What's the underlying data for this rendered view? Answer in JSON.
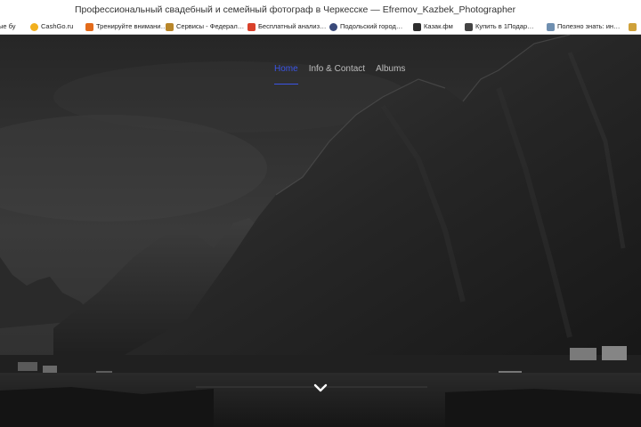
{
  "window": {
    "title": "Профессиональный свадебный и семейный фотограф в Черкесске — Efremov_Kazbek_Photographer"
  },
  "bookmarks": [
    {
      "label": "ые бу",
      "icon": "bookmark-page-icon",
      "color": "#9aa4b1"
    },
    {
      "label": "CashGo.ru",
      "icon": "cashgo-icon",
      "color": "#f2b01e"
    },
    {
      "label": "Тренируйте внимани…",
      "icon": "bookmark-page-icon",
      "color": "#e36b1b"
    },
    {
      "label": "Сервисы - Федерал…",
      "icon": "bookmark-page-icon",
      "color": "#b8862a"
    },
    {
      "label": "Бесплатный анализ…",
      "icon": "calendar-icon",
      "color": "#d9412b"
    },
    {
      "label": "Подольский город…",
      "icon": "bookmark-page-icon",
      "color": "#3a4a7a"
    },
    {
      "label": "Казак.фм",
      "icon": "bookmark-page-icon",
      "color": "#2d2d2d"
    },
    {
      "label": "Купить в 1Подар…",
      "icon": "bookmark-page-icon",
      "color": "#444444"
    },
    {
      "label": "Полезно знать: ин…",
      "icon": "bookmark-page-icon",
      "color": "#6f8fb0"
    },
    {
      "label": "",
      "icon": "bookmark-page-icon",
      "color": "#cfa13a"
    }
  ],
  "nav": {
    "home": "Home",
    "info": "Info & Contact",
    "albums": "Albums",
    "accent": "#3b55e6"
  },
  "hero": {
    "scroll_icon": "chevron-down-icon"
  }
}
